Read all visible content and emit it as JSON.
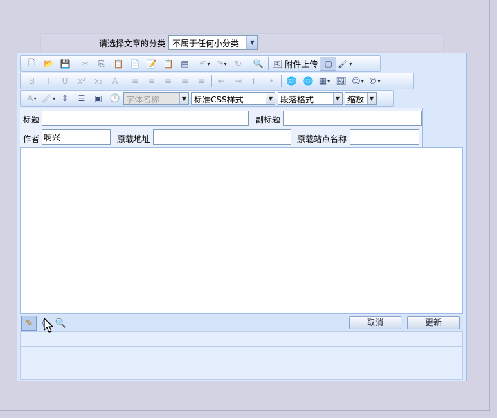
{
  "category": {
    "label": "请选择文章的分类",
    "selected": "不属于任何小分类"
  },
  "toolbar1": {
    "items": [
      {
        "name": "new-doc-icon",
        "glyph": "🗋",
        "dim": false
      },
      {
        "name": "open-icon",
        "glyph": "📂",
        "dim": false
      },
      {
        "name": "save-icon",
        "glyph": "💾",
        "dim": false
      },
      {
        "name": "cut-icon",
        "glyph": "✂",
        "dim": true
      },
      {
        "name": "copy-icon",
        "glyph": "⎘",
        "dim": false
      },
      {
        "name": "paste-icon",
        "glyph": "📋",
        "dim": true
      },
      {
        "name": "paste-text-icon",
        "glyph": "📄",
        "dim": false
      },
      {
        "name": "paste-word-icon",
        "glyph": "📝",
        "dim": false
      },
      {
        "name": "paste-plain-icon",
        "glyph": "📋",
        "dim": false
      },
      {
        "name": "paste-excel-icon",
        "glyph": "▤",
        "dim": false
      },
      {
        "name": "undo-icon",
        "glyph": "↶",
        "dim": true,
        "drop": true
      },
      {
        "name": "redo-icon",
        "glyph": "↷",
        "dim": true,
        "drop": true
      },
      {
        "name": "refresh-icon",
        "glyph": "↻",
        "dim": true
      },
      {
        "name": "find-icon",
        "glyph": "🔍",
        "dim": false
      }
    ],
    "upload_label": "附件上传"
  },
  "toolbar2": {
    "items": [
      {
        "name": "bold-icon",
        "glyph": "B",
        "dim": true
      },
      {
        "name": "italic-icon",
        "glyph": "I",
        "dim": true
      },
      {
        "name": "underline-icon",
        "glyph": "U",
        "dim": true
      },
      {
        "name": "superscript-icon",
        "glyph": "x²",
        "dim": true
      },
      {
        "name": "subscript-icon",
        "glyph": "x₂",
        "dim": true
      },
      {
        "name": "strikethrough-icon",
        "glyph": "A",
        "dim": true
      },
      {
        "name": "align-left-icon",
        "glyph": "≡",
        "dim": true
      },
      {
        "name": "align-center-icon",
        "glyph": "≡",
        "dim": true
      },
      {
        "name": "align-right-icon",
        "glyph": "≡",
        "dim": true
      },
      {
        "name": "justify-icon",
        "glyph": "≡",
        "dim": true
      },
      {
        "name": "justify-full-icon",
        "glyph": "≡",
        "dim": true
      },
      {
        "name": "outdent-icon",
        "glyph": "⇤",
        "dim": true
      },
      {
        "name": "indent-icon",
        "glyph": "⇥",
        "dim": true
      },
      {
        "name": "ordered-list-icon",
        "glyph": "⒈",
        "dim": true
      },
      {
        "name": "unordered-list-icon",
        "glyph": "•",
        "dim": true
      },
      {
        "name": "link-icon",
        "glyph": "🌐",
        "dim": false
      },
      {
        "name": "unlink-icon",
        "glyph": "🌐",
        "dim": true
      },
      {
        "name": "table-icon",
        "glyph": "▦",
        "dim": false,
        "drop": true
      },
      {
        "name": "image-icon",
        "glyph": "🖼",
        "dim": false
      },
      {
        "name": "emoticon-icon",
        "glyph": "☺",
        "dim": false,
        "drop": true
      },
      {
        "name": "special-char-icon",
        "glyph": "©",
        "dim": false,
        "drop": true
      }
    ]
  },
  "toolbar3": {
    "items": [
      {
        "name": "font-color-icon",
        "glyph": "A",
        "dim": true,
        "drop": true
      },
      {
        "name": "highlight-icon",
        "glyph": "🖌",
        "dim": true,
        "drop": true
      },
      {
        "name": "line-height-icon",
        "glyph": "↕",
        "dim": false
      },
      {
        "name": "paragraph-icon",
        "glyph": "☰",
        "dim": false
      },
      {
        "name": "template-icon",
        "glyph": "▣",
        "dim": false
      },
      {
        "name": "datetime-icon",
        "glyph": "🕒",
        "dim": true
      }
    ],
    "font_name": "字体名称",
    "css_style": "标准CSS样式",
    "paragraph_format": "段落格式",
    "zoom": "缩放"
  },
  "fields": {
    "title_label": "标题",
    "subtitle_label": "副标题",
    "author_label": "作者",
    "author_value": "啊兴",
    "source_url_label": "原载地址",
    "source_site_label": "原载站点名称"
  },
  "bottom": {
    "cancel_label": "取消",
    "update_label": "更新"
  },
  "colors": {
    "accent": "#9ebbe8",
    "toolbar_bg": "#d3e2f8",
    "page_bg": "#d3d3e4"
  }
}
